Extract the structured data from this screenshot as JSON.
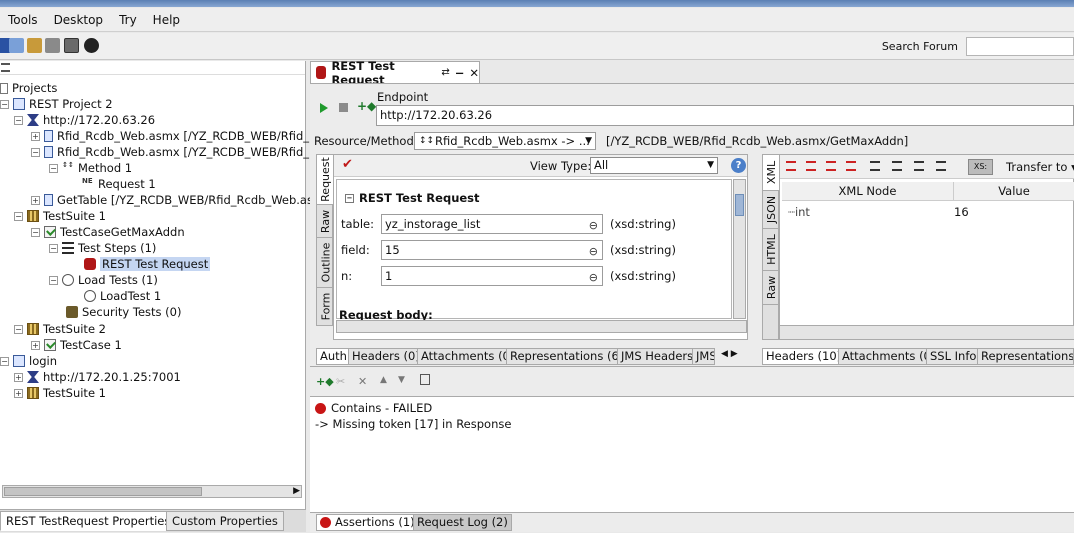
{
  "menu": [
    "Tools",
    "Desktop",
    "Try",
    "Help"
  ],
  "toolbar": {
    "search_label": "Search Forum",
    "search_value": ""
  },
  "navigator": {
    "root": "Projects",
    "items": [
      {
        "label": "REST Project 2",
        "icon": "project-icon"
      },
      {
        "label": "http://172.20.63.26",
        "icon": "interface-icon"
      },
      {
        "label": "Rfid_Rcdb_Web.asmx [/YZ_RCDB_WEB/Rfid_R",
        "icon": "resource-icon"
      },
      {
        "label": "Rfid_Rcdb_Web.asmx [/YZ_RCDB_WEB/Rfid_R",
        "icon": "resource-icon"
      },
      {
        "label": "Method 1",
        "icon": "method-icon"
      },
      {
        "label": "Request 1",
        "icon": "request-icon"
      },
      {
        "label": "GetTable [/YZ_RCDB_WEB/Rfid_Rcdb_Web.as",
        "icon": "resource-icon"
      },
      {
        "label": "TestSuite 1",
        "icon": "testsuite-icon"
      },
      {
        "label": "TestCaseGetMaxAddn",
        "icon": "testcase-icon"
      },
      {
        "label": "Test Steps (1)",
        "icon": "teststeps-icon"
      },
      {
        "label": "REST Test Request",
        "icon": "rest-request-icon"
      },
      {
        "label": "Load Tests (1)",
        "icon": "loadtests-icon"
      },
      {
        "label": "LoadTest 1",
        "icon": "loadtest-icon"
      },
      {
        "label": "Security Tests (0)",
        "icon": "security-icon"
      },
      {
        "label": "TestSuite 2",
        "icon": "testsuite-icon"
      },
      {
        "label": "TestCase 1",
        "icon": "testcase-icon"
      },
      {
        "label": "login",
        "icon": "project-icon"
      },
      {
        "label": "http://172.20.1.25:7001",
        "icon": "interface-icon"
      },
      {
        "label": "TestSuite 1",
        "icon": "testsuite-icon"
      }
    ]
  },
  "property_tabs": [
    "REST TestRequest Properties",
    "Custom Properties"
  ],
  "editor": {
    "tab_title": "REST Test Request",
    "endpoint_label": "Endpoint",
    "endpoint_value": "http://172.20.63.26",
    "resource_method_label": "Resource/Method:",
    "resource_method_value": "Rfid_Rcdb_Web.asmx -> ...",
    "resource_path": "[/YZ_RCDB_WEB/Rfid_Rcdb_Web.asmx/GetMaxAddn]",
    "request_vtabs": [
      "Request",
      "Raw",
      "Outline",
      "Form"
    ],
    "view_type_label": "View Type:",
    "view_type_value": "All",
    "form_title": "REST Test Request",
    "fields": [
      {
        "label": "table:",
        "value": "yz_instorage_list",
        "type": "(xsd:string)"
      },
      {
        "label": "field:",
        "value": "15",
        "type": "(xsd:string)"
      },
      {
        "label": "n:",
        "value": "1",
        "type": "(xsd:string)"
      }
    ],
    "request_body_label": "Request body:",
    "request_bottom_tabs": [
      "Auth",
      "Headers (0)",
      "Attachments (0)",
      "Representations (6)",
      "JMS Headers",
      "JMS"
    ],
    "response_vtabs": [
      "XML",
      "JSON",
      "HTML",
      "Raw"
    ],
    "transfer_label": "Transfer to",
    "response_columns": [
      "XML Node",
      "Value"
    ],
    "response_rows": [
      {
        "node": "int",
        "value": "16"
      }
    ],
    "response_bottom_tabs": [
      "Headers (10)",
      "Attachments (0)",
      "SSL Info",
      "Representations ("
    ],
    "assertion_lines": [
      "Contains - FAILED",
      "-> Missing token [17] in Response"
    ],
    "lower_tabs": [
      "Assertions (1)",
      "Request Log (2)"
    ]
  }
}
